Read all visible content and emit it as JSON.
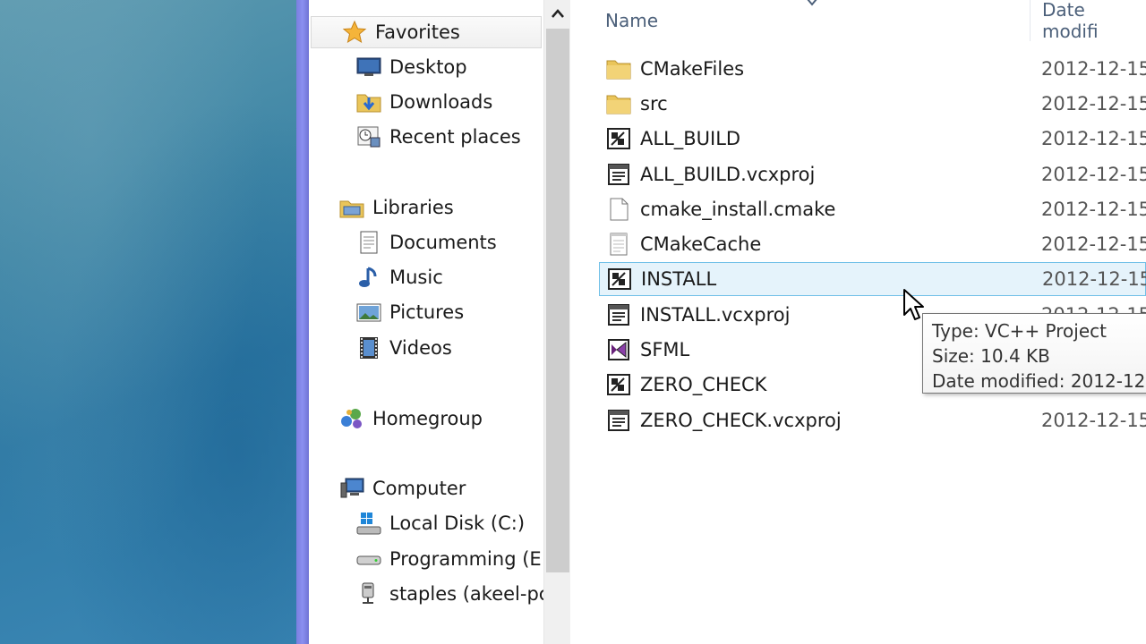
{
  "nav": {
    "favorites": "Favorites",
    "desktop": "Desktop",
    "downloads": "Downloads",
    "recent_places": "Recent places",
    "libraries": "Libraries",
    "documents": "Documents",
    "music": "Music",
    "pictures": "Pictures",
    "videos": "Videos",
    "homegroup": "Homegroup",
    "computer": "Computer",
    "local_disk": "Local Disk (C:)",
    "programming": "Programming (E:",
    "staples": "staples (akeel-pc)"
  },
  "header": {
    "name": "Name",
    "date_modified": "Date modifi"
  },
  "files": [
    {
      "name": "CMakeFiles",
      "date": "2012-12-15",
      "icon": "folder-icon"
    },
    {
      "name": "src",
      "date": "2012-12-15",
      "icon": "folder-icon"
    },
    {
      "name": "ALL_BUILD",
      "date": "2012-12-15",
      "icon": "vcxproj-icon"
    },
    {
      "name": "ALL_BUILD.vcxproj",
      "date": "2012-12-15",
      "icon": "filters-file-icon"
    },
    {
      "name": "cmake_install.cmake",
      "date": "2012-12-15",
      "icon": "blank-file-icon"
    },
    {
      "name": "CMakeCache",
      "date": "2012-12-15",
      "icon": "text-file-icon"
    },
    {
      "name": "INSTALL",
      "date": "2012-12-15",
      "icon": "vcxproj-icon"
    },
    {
      "name": "INSTALL.vcxproj",
      "date": "2012-12-15",
      "icon": "filters-file-icon"
    },
    {
      "name": "SFML",
      "date": "",
      "icon": "solution-icon"
    },
    {
      "name": "ZERO_CHECK",
      "date": "",
      "icon": "vcxproj-icon"
    },
    {
      "name": "ZERO_CHECK.vcxproj",
      "date": "2012-12-15",
      "icon": "filters-file-icon"
    }
  ],
  "tooltip": {
    "type": "Type: VC++ Project",
    "size": "Size: 10.4 KB",
    "date": "Date modified: 2012-12-"
  },
  "colors": {
    "hover_bg": "#e5f3fb",
    "hover_border": "#70c0e7",
    "window_border": "#7b7fe0",
    "header_text": "#4c607a"
  }
}
